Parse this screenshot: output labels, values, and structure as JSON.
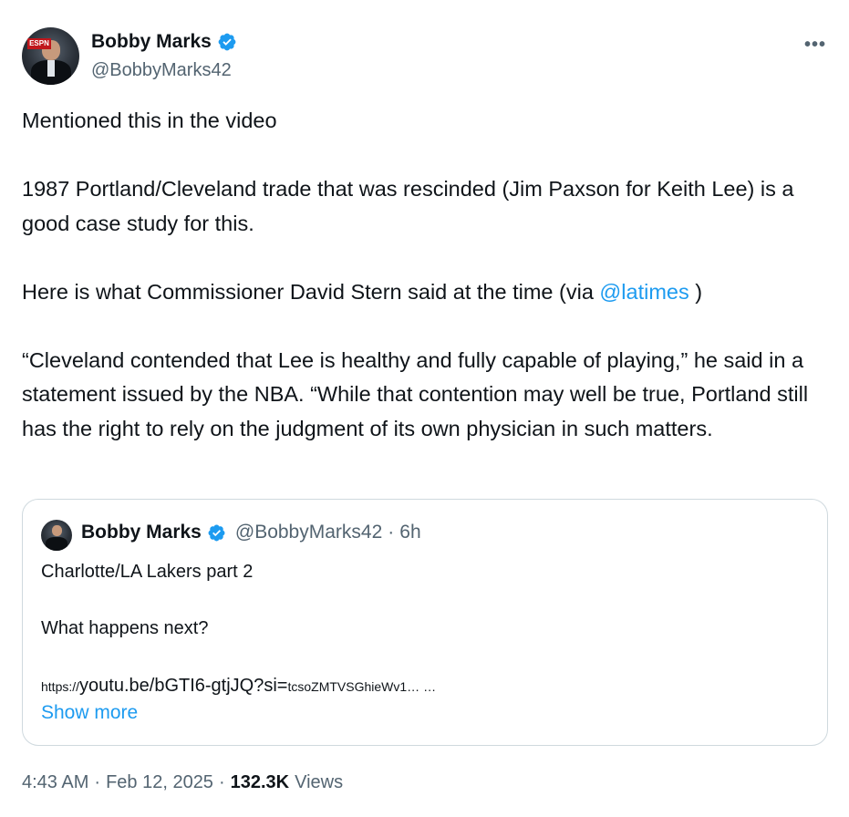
{
  "author": {
    "display_name": "Bobby Marks",
    "handle": "@BobbyMarks42",
    "verified_icon": "verified-badge-icon",
    "avatar_logo": "ESPN"
  },
  "menu": {
    "more_label": "•••"
  },
  "tweet": {
    "para1": "Mentioned this in the video",
    "para2": "1987 Portland/Cleveland trade that was rescinded (Jim Paxson for Keith Lee) is a good case study for this.",
    "para3_pre": "Here is what Commissioner David Stern said at the time (via ",
    "para3_mention": "@latimes",
    "para3_post": " )",
    "para4": "“Cleveland contended that Lee is healthy and fully capable of playing,” he said in a statement issued by the NBA. “While that contention may well be true, Portland still has the right to rely on the judgment of its own physician in such matters."
  },
  "quote": {
    "display_name": "Bobby Marks",
    "handle": "@BobbyMarks42",
    "separator": "·",
    "time": "6h",
    "line1": "Charlotte/LA Lakers part 2",
    "line2": "What happens next?",
    "link_scheme": "https://",
    "link_main": "youtu.be/bGTI6-gtjJQ?si=",
    "link_tail": "tcsoZMTVSGhieWv1… …",
    "show_more": "Show more"
  },
  "meta": {
    "time": "4:43 AM",
    "sep1": "·",
    "date": "Feb 12, 2025",
    "sep2": "·",
    "views_count": "132.3K",
    "views_label": "Views"
  },
  "colors": {
    "link": "#1d9bf0",
    "secondary_text": "#536471",
    "primary_text": "#0f1419",
    "border": "#cfd9de"
  }
}
